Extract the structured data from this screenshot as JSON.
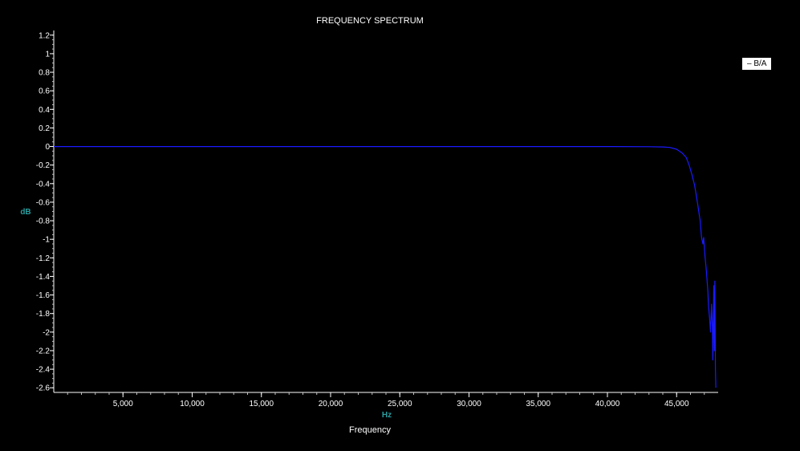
{
  "chart_data": {
    "type": "line",
    "title": "FREQUENCY SPECTRUM",
    "xlabel": "Frequency",
    "x_unit": "Hz",
    "y_unit": "dB",
    "xlim": [
      0,
      48000
    ],
    "ylim": [
      -2.65,
      1.25
    ],
    "x_ticks": [
      {
        "value": 5000,
        "label": "5,000"
      },
      {
        "value": 10000,
        "label": "10,000"
      },
      {
        "value": 15000,
        "label": "15,000"
      },
      {
        "value": 20000,
        "label": "20,000"
      },
      {
        "value": 25000,
        "label": "25,000"
      },
      {
        "value": 30000,
        "label": "30,000"
      },
      {
        "value": 35000,
        "label": "35,000"
      },
      {
        "value": 40000,
        "label": "40,000"
      },
      {
        "value": 45000,
        "label": "45,000"
      }
    ],
    "y_ticks": [
      {
        "value": 1.2,
        "label": "1.2"
      },
      {
        "value": 1.0,
        "label": "1"
      },
      {
        "value": 0.8,
        "label": "0.8"
      },
      {
        "value": 0.6,
        "label": "0.6"
      },
      {
        "value": 0.4,
        "label": "0.4"
      },
      {
        "value": 0.2,
        "label": "0.2"
      },
      {
        "value": 0.0,
        "label": "0"
      },
      {
        "value": -0.2,
        "label": "-0.2"
      },
      {
        "value": -0.4,
        "label": "-0.4"
      },
      {
        "value": -0.6,
        "label": "-0.6"
      },
      {
        "value": -0.8,
        "label": "-0.8"
      },
      {
        "value": -1.0,
        "label": "-1"
      },
      {
        "value": -1.2,
        "label": "-1.2"
      },
      {
        "value": -1.4,
        "label": "-1.4"
      },
      {
        "value": -1.6,
        "label": "-1.6"
      },
      {
        "value": -1.8,
        "label": "-1.8"
      },
      {
        "value": -2.0,
        "label": "-2"
      },
      {
        "value": -2.2,
        "label": "-2.2"
      },
      {
        "value": -2.4,
        "label": "-2.4"
      },
      {
        "value": -2.6,
        "label": "-2.6"
      }
    ],
    "legend": {
      "position": "top-right",
      "label": "– B/A"
    },
    "grid": false,
    "series": [
      {
        "name": "B/A",
        "color": "#1a1aff",
        "x": [
          0,
          5000,
          10000,
          15000,
          20000,
          25000,
          30000,
          35000,
          40000,
          43000,
          44000,
          44500,
          45000,
          45400,
          45700,
          45900,
          46100,
          46300,
          46500,
          46700,
          46800,
          46900,
          46950,
          47050,
          47150,
          47250,
          47300,
          47380,
          47450,
          47520,
          47580,
          47620,
          47680,
          47720,
          47760,
          47800,
          47830
        ],
        "y": [
          0,
          0,
          0,
          0,
          0,
          0,
          0,
          0,
          0,
          -0.002,
          -0.005,
          -0.01,
          -0.03,
          -0.07,
          -0.12,
          -0.2,
          -0.3,
          -0.42,
          -0.6,
          -0.8,
          -0.98,
          -1.05,
          -0.98,
          -1.18,
          -1.34,
          -1.55,
          -1.7,
          -1.85,
          -2.0,
          -1.7,
          -1.95,
          -2.3,
          -1.5,
          -2.2,
          -1.45,
          -2.4,
          -2.6
        ]
      }
    ]
  }
}
